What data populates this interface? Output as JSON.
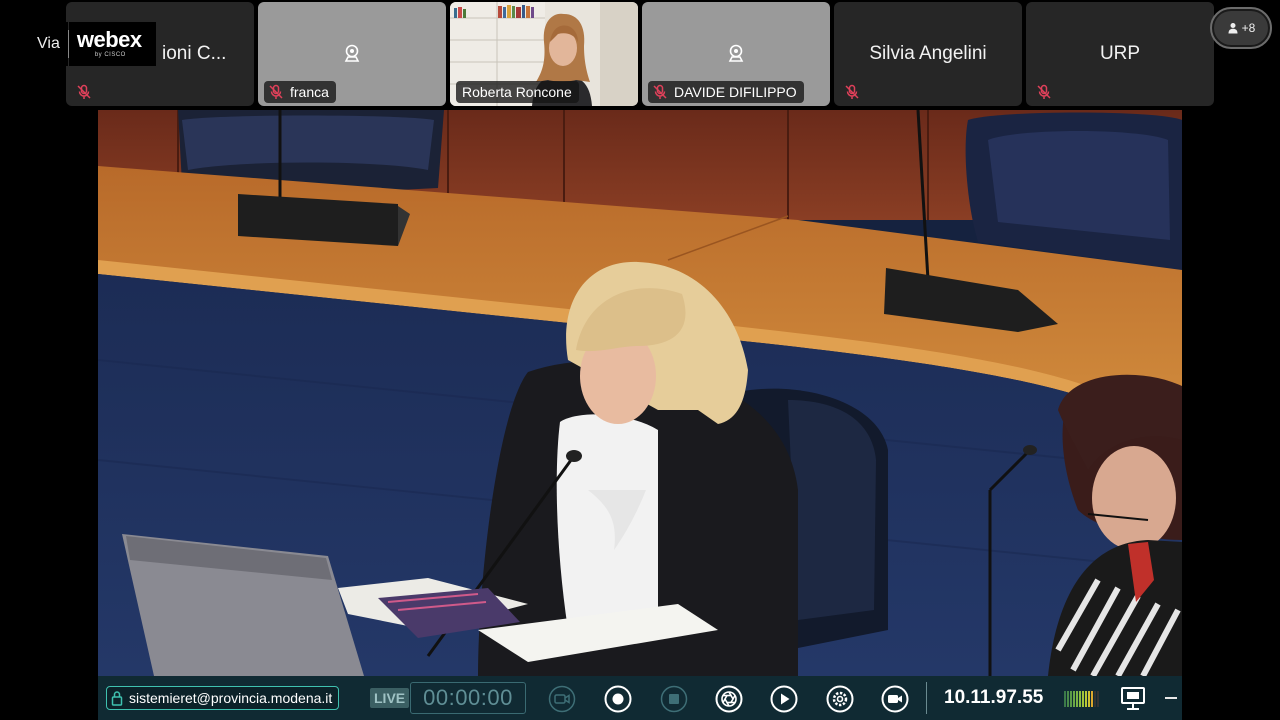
{
  "webex_badge": {
    "via": "Via",
    "brand": "webex",
    "brand_sub": "by CISCO"
  },
  "participants": [
    {
      "name": "...ioni C...",
      "muted": true
    },
    {
      "name": "franca",
      "muted": true
    },
    {
      "name": "Roberta Roncone",
      "muted": false
    },
    {
      "name": "DAVIDE DIFILIPPO",
      "muted": true
    },
    {
      "name": "Silvia Angelini",
      "muted": true
    },
    {
      "name": "URP",
      "muted": true
    }
  ],
  "tile_first_visible_text": "ioni C...",
  "more_participants": {
    "label": "+8",
    "icon": "person-icon"
  },
  "controls": {
    "user": "sistemieret@provincia.modena.it",
    "live": "LIVE",
    "timer": "00:00:00",
    "ip": "10.11.97.55",
    "icons": [
      "camera-off-icon",
      "record-icon",
      "stop-icon",
      "aperture-icon",
      "play-icon",
      "settings-icon",
      "camera-icon",
      "monitor-icon",
      "minimize-icon"
    ]
  },
  "colors": {
    "control_bar": "#102a33",
    "accent": "#3fc1b0",
    "muted_mic": "#e0405a"
  }
}
